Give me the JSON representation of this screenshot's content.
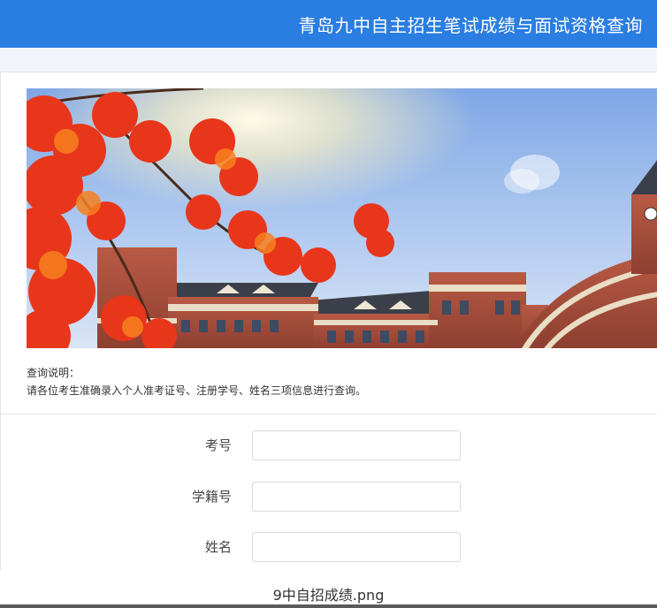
{
  "header": {
    "title": "青岛九中自主招生笔试成绩与面试资格查询"
  },
  "banner": {
    "image": "campus-autumn-maple-banner"
  },
  "notice": {
    "title": "查询说明：",
    "text": "请各位考生准确录入个人准考证号、注册学号、姓名三项信息进行查询。"
  },
  "form": {
    "fields": [
      {
        "label": "考号",
        "value": "",
        "placeholder": ""
      },
      {
        "label": "学籍号",
        "value": "",
        "placeholder": ""
      },
      {
        "label": "姓名",
        "value": "",
        "placeholder": ""
      }
    ]
  },
  "caption": {
    "text": "9中自招成绩.png"
  },
  "colors": {
    "header_bg": "#2a7de1",
    "header_text": "#ffffff",
    "band_bg": "#f2f5f9"
  }
}
